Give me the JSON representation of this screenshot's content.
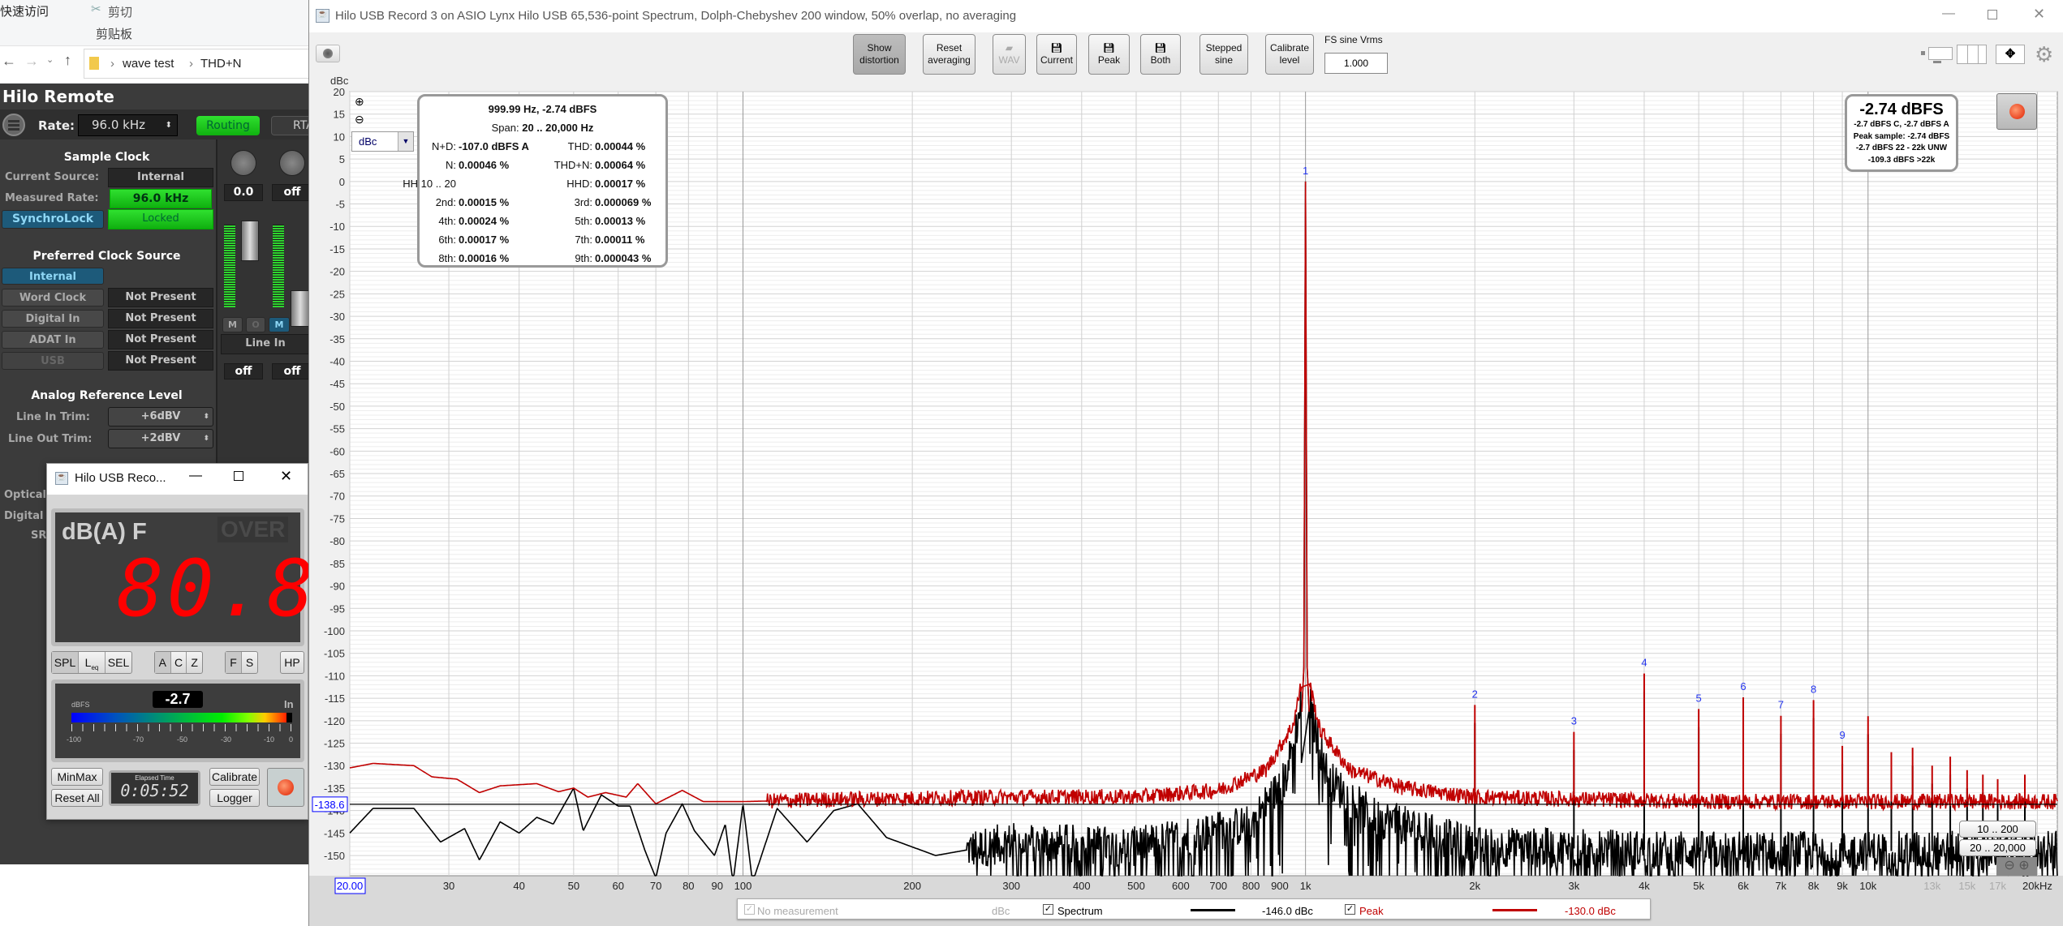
{
  "explorer": {
    "quick_access": "快速访问",
    "cut": "剪切",
    "clipboard": "剪贴板",
    "path": [
      "wave test",
      "THD+N"
    ]
  },
  "hilo_remote": {
    "title": "Hilo Remote",
    "rate_label": "Rate:",
    "rate_value": "96.0 kHz",
    "routing": "Routing",
    "rta": "RTA",
    "sample_clock": {
      "title": "Sample Clock",
      "current_source_label": "Current Source:",
      "current_source": "Internal",
      "measured_rate_label": "Measured Rate:",
      "measured_rate": "96.0 kHz",
      "synchrolock": "SynchroLock",
      "lock_status": "Locked"
    },
    "preferred_clock": {
      "title": "Preferred Clock Source",
      "sources": [
        {
          "name": "Internal",
          "status": ""
        },
        {
          "name": "Word Clock",
          "status": "Not Present"
        },
        {
          "name": "Digital In",
          "status": "Not Present"
        },
        {
          "name": "ADAT In",
          "status": "Not Present"
        },
        {
          "name": "USB",
          "status": "Not Present"
        }
      ]
    },
    "analog_ref": {
      "title": "Analog Reference Level",
      "line_in_label": "Line In Trim:",
      "line_in": "+6dBV",
      "line_out_label": "Line Out Trim:",
      "line_out": "+2dBV"
    },
    "mixer": {
      "trim_left": "0.0",
      "trim_right": "off",
      "mute_l": "M",
      "solo": "O",
      "mute_r": "M",
      "source": "Line In",
      "out_left": "off",
      "out_right": "off",
      "knob_l": "L",
      "knob_r": "R"
    },
    "hidden_labels": [
      "Optical",
      "Digital",
      "SR"
    ]
  },
  "meter_window": {
    "title": "Hilo USB Reco...",
    "mode": "dB(A) F",
    "over": "OVER",
    "reading": "80.8",
    "buttons_mode": [
      "SPL",
      "L",
      "SEL"
    ],
    "leq_sub": "eq",
    "buttons_weight": [
      "A",
      "C",
      "Z"
    ],
    "buttons_time": [
      "F",
      "S"
    ],
    "hp": "HP",
    "level_unit": "dBFS",
    "level_value": "-2.7",
    "level_channel": "In",
    "level_fraction": 0.973,
    "scale": [
      "-100",
      "-70",
      "-50",
      "-30",
      "-10",
      "0"
    ],
    "minmax": "MinMax",
    "reset_all": "Reset All",
    "elapsed_label": "Elapsed Time",
    "elapsed": "0:05:52",
    "calibrate": "Calibrate",
    "logger": "Logger"
  },
  "main_window": {
    "title": "Hilo USB Record 3 on ASIO Lynx Hilo USB 65,536-point Spectrum, Dolph-Chebyshev 200 window, 50% overlap, no averaging",
    "toolbar": {
      "show_distortion": [
        "Show",
        "distortion"
      ],
      "reset_averaging": [
        "Reset",
        "averaging"
      ],
      "wav": "WAV",
      "current": "Current",
      "peak": "Peak",
      "both": "Both",
      "stepped_sine": [
        "Stepped",
        "sine"
      ],
      "calibrate_level": [
        "Calibrate",
        "level"
      ],
      "fs_label": "FS sine Vrms",
      "fs_value": "1.000"
    },
    "unit_select": "dBc",
    "stats": {
      "header": "999.99 Hz, -2.74 dBFS",
      "span_label": "Span:",
      "span_value": "20 .. 20,000 Hz",
      "rows": [
        [
          {
            "label": "N+D:",
            "value": "-107.0 dBFS A"
          },
          {
            "label": "THD:",
            "value": "0.00044 %"
          }
        ],
        [
          {
            "label": "N:",
            "value": "0.00046 %"
          },
          {
            "label": "THD+N:",
            "value": "0.00064 %"
          }
        ],
        [
          {
            "label": "HH 10 .. 20",
            "value": ""
          },
          {
            "label": "HHD:",
            "value": "0.00017 %"
          }
        ],
        [
          {
            "label": "2nd:",
            "value": "0.00015 %"
          },
          {
            "label": "3rd:",
            "value": "0.000069 %"
          }
        ],
        [
          {
            "label": "4th:",
            "value": "0.00024 %"
          },
          {
            "label": "5th:",
            "value": "0.00013 %"
          }
        ],
        [
          {
            "label": "6th:",
            "value": "0.00017 %"
          },
          {
            "label": "7th:",
            "value": "0.00011 %"
          }
        ],
        [
          {
            "label": "8th:",
            "value": "0.00016 %"
          },
          {
            "label": "9th:",
            "value": "0.000043 %"
          }
        ]
      ]
    },
    "level": {
      "main": "-2.74 dBFS",
      "lines": [
        "-2.7 dBFS C, -2.7 dBFS A",
        "Peak sample: -2.74 dBFS",
        "-2.7 dBFS 22 - 22k UNW",
        "-109.3 dBFS >22k"
      ]
    },
    "range_buttons": [
      "10 .. 200",
      "20 .. 20,000"
    ],
    "legend": {
      "no_measurement": "No measurement",
      "no_measurement_unit": "dBc",
      "spectrum": "Spectrum",
      "spectrum_value": "-146.0 dBc",
      "peak": "Peak",
      "peak_value": "-130.0 dBc"
    }
  },
  "chart_data": {
    "type": "line",
    "ylabel": "dBc",
    "xlim": [
      20,
      21700
    ],
    "ylim": [
      -154.5,
      20
    ],
    "xscale": "log",
    "y_ticks": [
      20,
      15,
      10,
      5,
      0,
      -5,
      -10,
      -15,
      -20,
      -25,
      -30,
      -35,
      -40,
      -45,
      -50,
      -55,
      -60,
      -65,
      -70,
      -75,
      -80,
      -85,
      -90,
      -95,
      -100,
      -105,
      -110,
      -115,
      -120,
      -125,
      -130,
      -135,
      -140,
      -145,
      -150
    ],
    "x_ticks": [
      {
        "f": 30,
        "label": "30"
      },
      {
        "f": 40,
        "label": "40"
      },
      {
        "f": 50,
        "label": "50"
      },
      {
        "f": 60,
        "label": "60"
      },
      {
        "f": 70,
        "label": "70"
      },
      {
        "f": 80,
        "label": "80"
      },
      {
        "f": 90,
        "label": "90"
      },
      {
        "f": 100,
        "label": "100"
      },
      {
        "f": 200,
        "label": "200"
      },
      {
        "f": 300,
        "label": "300"
      },
      {
        "f": 400,
        "label": "400"
      },
      {
        "f": 500,
        "label": "500"
      },
      {
        "f": 600,
        "label": "600"
      },
      {
        "f": 700,
        "label": "700"
      },
      {
        "f": 800,
        "label": "800"
      },
      {
        "f": 900,
        "label": "900"
      },
      {
        "f": 1000,
        "label": "1k"
      },
      {
        "f": 2000,
        "label": "2k"
      },
      {
        "f": 3000,
        "label": "3k"
      },
      {
        "f": 4000,
        "label": "4k"
      },
      {
        "f": 5000,
        "label": "5k"
      },
      {
        "f": 6000,
        "label": "6k"
      },
      {
        "f": 7000,
        "label": "7k"
      },
      {
        "f": 8000,
        "label": "8k"
      },
      {
        "f": 9000,
        "label": "9k"
      },
      {
        "f": 10000,
        "label": "10k"
      },
      {
        "f": 13000,
        "label": "13k",
        "dim": true
      },
      {
        "f": 15000,
        "label": "15k",
        "dim": true
      },
      {
        "f": 17000,
        "label": "17k",
        "dim": true
      },
      {
        "f": 20000,
        "label": "20kHz"
      }
    ],
    "grid": true,
    "cursor": {
      "x_label": "20.00",
      "y_label": "-138.6",
      "y": -138.6
    },
    "harmonics": [
      {
        "n": "1",
        "f": 1000,
        "dbc": 0
      },
      {
        "n": "2",
        "f": 2000,
        "dbc": -116.5
      },
      {
        "n": "3",
        "f": 3000,
        "dbc": -122.5
      },
      {
        "n": "4",
        "f": 4000,
        "dbc": -109.5
      },
      {
        "n": "5",
        "f": 5000,
        "dbc": -117.4
      },
      {
        "n": "6",
        "f": 6000,
        "dbc": -114.8
      },
      {
        "n": "7",
        "f": 7000,
        "dbc": -118.9
      },
      {
        "n": "8",
        "f": 8000,
        "dbc": -115.4
      },
      {
        "n": "9",
        "f": 9000,
        "dbc": -125.6
      }
    ],
    "other_spurs": [
      {
        "f": 10000,
        "dbc": -119
      },
      {
        "f": 11000,
        "dbc": -127
      },
      {
        "f": 12000,
        "dbc": -126
      },
      {
        "f": 13000,
        "dbc": -130
      },
      {
        "f": 14000,
        "dbc": -128
      },
      {
        "f": 15000,
        "dbc": -131
      },
      {
        "f": 16000,
        "dbc": -132
      },
      {
        "f": 17000,
        "dbc": -133
      },
      {
        "f": 19000,
        "dbc": -132
      }
    ],
    "series": [
      {
        "name": "Spectrum",
        "color": "#000000",
        "envelope": [
          [
            20,
            -145
          ],
          [
            22,
            -139.5
          ],
          [
            26,
            -139.5
          ],
          [
            29,
            -147
          ],
          [
            32,
            -144
          ],
          [
            34,
            -151
          ],
          [
            37,
            -142.5
          ],
          [
            40,
            -145
          ],
          [
            43,
            -141.5
          ],
          [
            46,
            -143
          ],
          [
            50,
            -135
          ],
          [
            52,
            -144.5
          ],
          [
            56,
            -136.5
          ],
          [
            60,
            -139
          ],
          [
            63,
            -139
          ],
          [
            67,
            -149
          ],
          [
            70,
            -155
          ],
          [
            73,
            -145
          ],
          [
            78,
            -138.5
          ],
          [
            82,
            -144.5
          ],
          [
            89,
            -150
          ],
          [
            93,
            -143
          ],
          [
            96,
            -156
          ],
          [
            100,
            -138.5
          ],
          [
            104,
            -156
          ],
          [
            115,
            -139.5
          ],
          [
            130,
            -147
          ],
          [
            145,
            -140
          ],
          [
            160,
            -138.5
          ],
          [
            180,
            -146
          ],
          [
            220,
            -150
          ],
          [
            300,
            -147
          ],
          [
            500,
            -148
          ],
          [
            800,
            -143
          ],
          [
            920,
            -133
          ],
          [
            970,
            -120
          ],
          [
            995,
            -110
          ],
          [
            1000,
            0
          ],
          [
            1005,
            -110
          ],
          [
            1030,
            -120
          ],
          [
            1100,
            -133
          ],
          [
            1300,
            -141
          ],
          [
            2000,
            -148
          ],
          [
            5000,
            -149
          ],
          [
            21700,
            -149
          ]
        ]
      },
      {
        "name": "Peak",
        "color": "#c00000",
        "envelope": [
          [
            20,
            -130.5
          ],
          [
            22,
            -129.5
          ],
          [
            26,
            -130
          ],
          [
            28,
            -132.5
          ],
          [
            31,
            -133
          ],
          [
            34,
            -136
          ],
          [
            37,
            -134.5
          ],
          [
            43,
            -134
          ],
          [
            47,
            -135.8
          ],
          [
            50,
            -135
          ],
          [
            53,
            -137
          ],
          [
            57,
            -136
          ],
          [
            62,
            -137
          ],
          [
            65,
            -134
          ],
          [
            70,
            -138.5
          ],
          [
            78,
            -135.5
          ],
          [
            85,
            -138
          ],
          [
            100,
            -138
          ],
          [
            150,
            -137.5
          ],
          [
            300,
            -137
          ],
          [
            500,
            -137
          ],
          [
            700,
            -135.5
          ],
          [
            850,
            -131
          ],
          [
            950,
            -121
          ],
          [
            990,
            -110
          ],
          [
            1000,
            0
          ],
          [
            1010,
            -110
          ],
          [
            1060,
            -122
          ],
          [
            1200,
            -131
          ],
          [
            1500,
            -135
          ],
          [
            2000,
            -137
          ],
          [
            5000,
            -138
          ],
          [
            21700,
            -138
          ]
        ]
      }
    ]
  }
}
